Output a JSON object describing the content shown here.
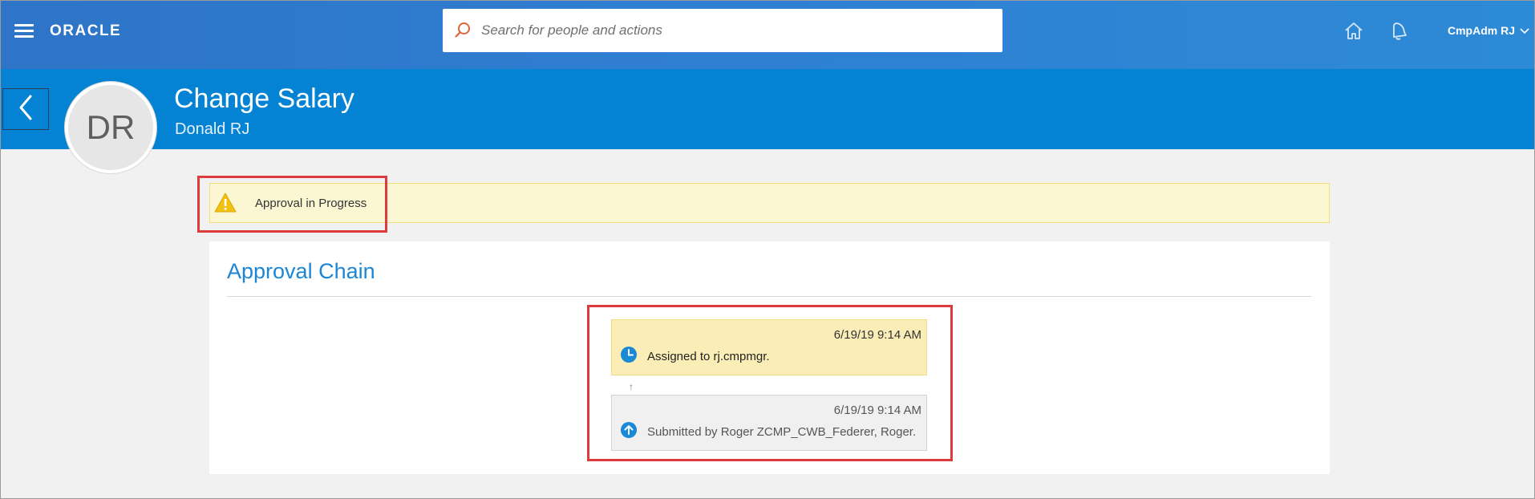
{
  "app": {
    "logo": "ORACLE",
    "search": {
      "placeholder": "Search for people and actions"
    },
    "user": {
      "name": "CmpAdm RJ"
    }
  },
  "icons": {
    "menu": "hamburger-menu-icon",
    "search": "magnifier-icon",
    "home": "home-icon",
    "notifications": "bell-icon",
    "back": "chevron-left-icon",
    "warning": "warning-triangle-icon",
    "assigned": "clock-icon",
    "submitted": "arrow-up-circle-icon"
  },
  "colors": {
    "topbar": "#2f7fd2",
    "header_band": "#0482d4",
    "accent_title": "#1b86d6",
    "warning_bg": "#fbf7d2",
    "assigned_bg": "#faeeb6",
    "submitted_bg": "#f0f0f0",
    "highlight": "#dd3b3d"
  },
  "header": {
    "avatar_initials": "DR",
    "title": "Change Salary",
    "subtitle": "Donald RJ"
  },
  "alert": {
    "text": "Approval in Progress"
  },
  "approval_chain": {
    "title": "Approval Chain",
    "connector": "↑",
    "steps": [
      {
        "timestamp": "6/19/19 9:14 AM",
        "message": "Assigned to rj.cmpmgr.",
        "status": "assigned"
      },
      {
        "timestamp": "6/19/19 9:14 AM",
        "message": "Submitted by Roger ZCMP_CWB_Federer, Roger.",
        "status": "submitted"
      }
    ]
  }
}
